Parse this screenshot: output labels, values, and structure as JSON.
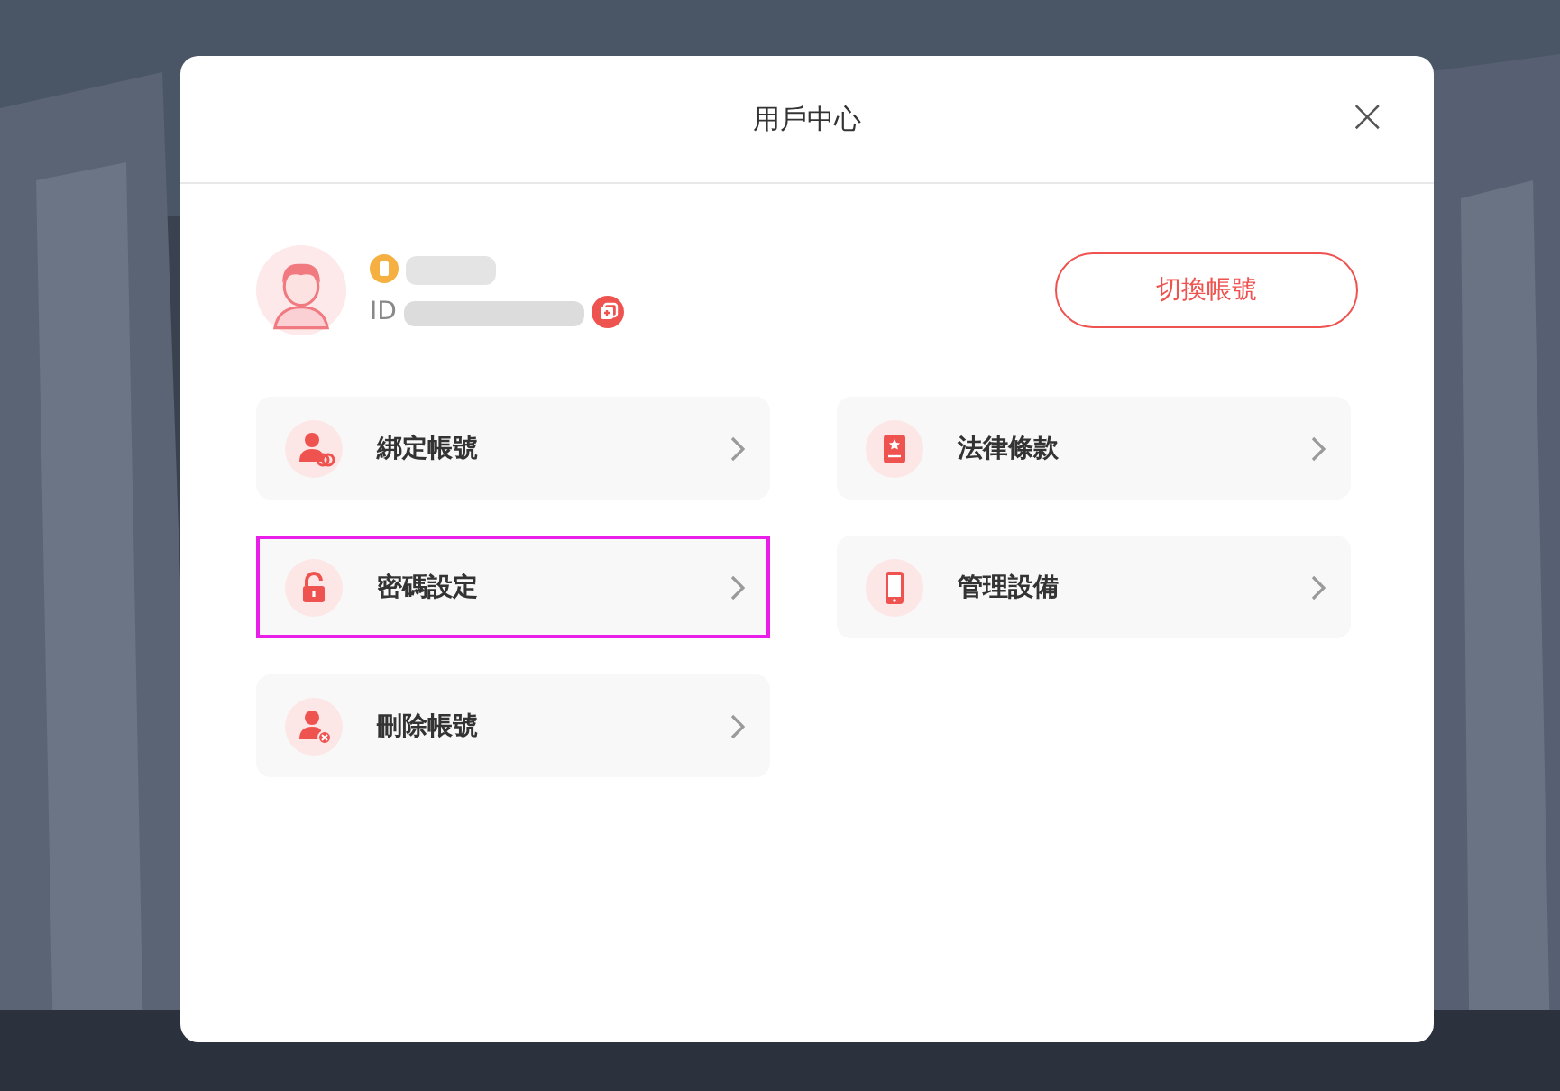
{
  "dialog": {
    "title": "用戶中心",
    "close": "×"
  },
  "profile": {
    "id_label": "ID",
    "switch_button": "切換帳號"
  },
  "menu": [
    {
      "label": "綁定帳號",
      "highlighted": false
    },
    {
      "label": "法律條款",
      "highlighted": false
    },
    {
      "label": "密碼設定",
      "highlighted": true
    },
    {
      "label": "管理設備",
      "highlighted": false
    },
    {
      "label": "刪除帳號",
      "highlighted": false
    }
  ]
}
